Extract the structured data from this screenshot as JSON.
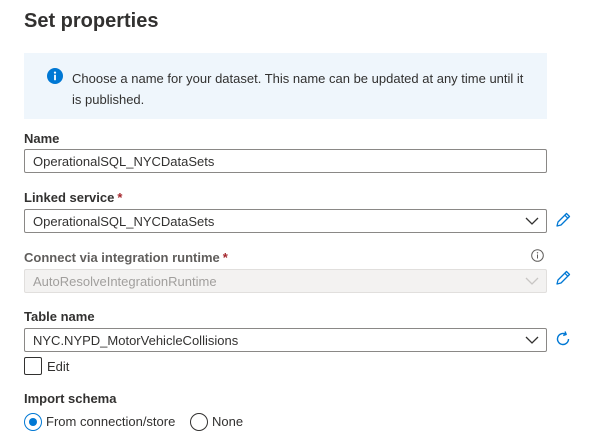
{
  "title": "Set properties",
  "info": {
    "icon": "info-icon",
    "text": "Choose a name for your dataset. This name can be updated at any time until it is published."
  },
  "name": {
    "label": "Name",
    "value": "OperationalSQL_NYCDataSets"
  },
  "linked_service": {
    "label": "Linked service",
    "required_mark": "*",
    "value": "OperationalSQL_NYCDataSets",
    "edit_icon": "pencil-icon"
  },
  "integration_runtime": {
    "label": "Connect via integration runtime",
    "required_mark": "*",
    "value": "AutoResolveIntegrationRuntime",
    "disabled": true,
    "help_icon": "info-circle-icon",
    "edit_icon": "pencil-icon"
  },
  "table_name": {
    "label": "Table name",
    "value": "NYC.NYPD_MotorVehicleCollisions",
    "refresh_icon": "refresh-icon",
    "edit_checkbox_label": "Edit",
    "edit_checked": false
  },
  "import_schema": {
    "label": "Import schema",
    "options": [
      {
        "label": "From connection/store",
        "selected": true
      },
      {
        "label": "None",
        "selected": false
      }
    ]
  },
  "colors": {
    "accent": "#0078d4",
    "info_bg": "#eff6fc",
    "required": "#a4262c",
    "border": "#8a8886"
  }
}
